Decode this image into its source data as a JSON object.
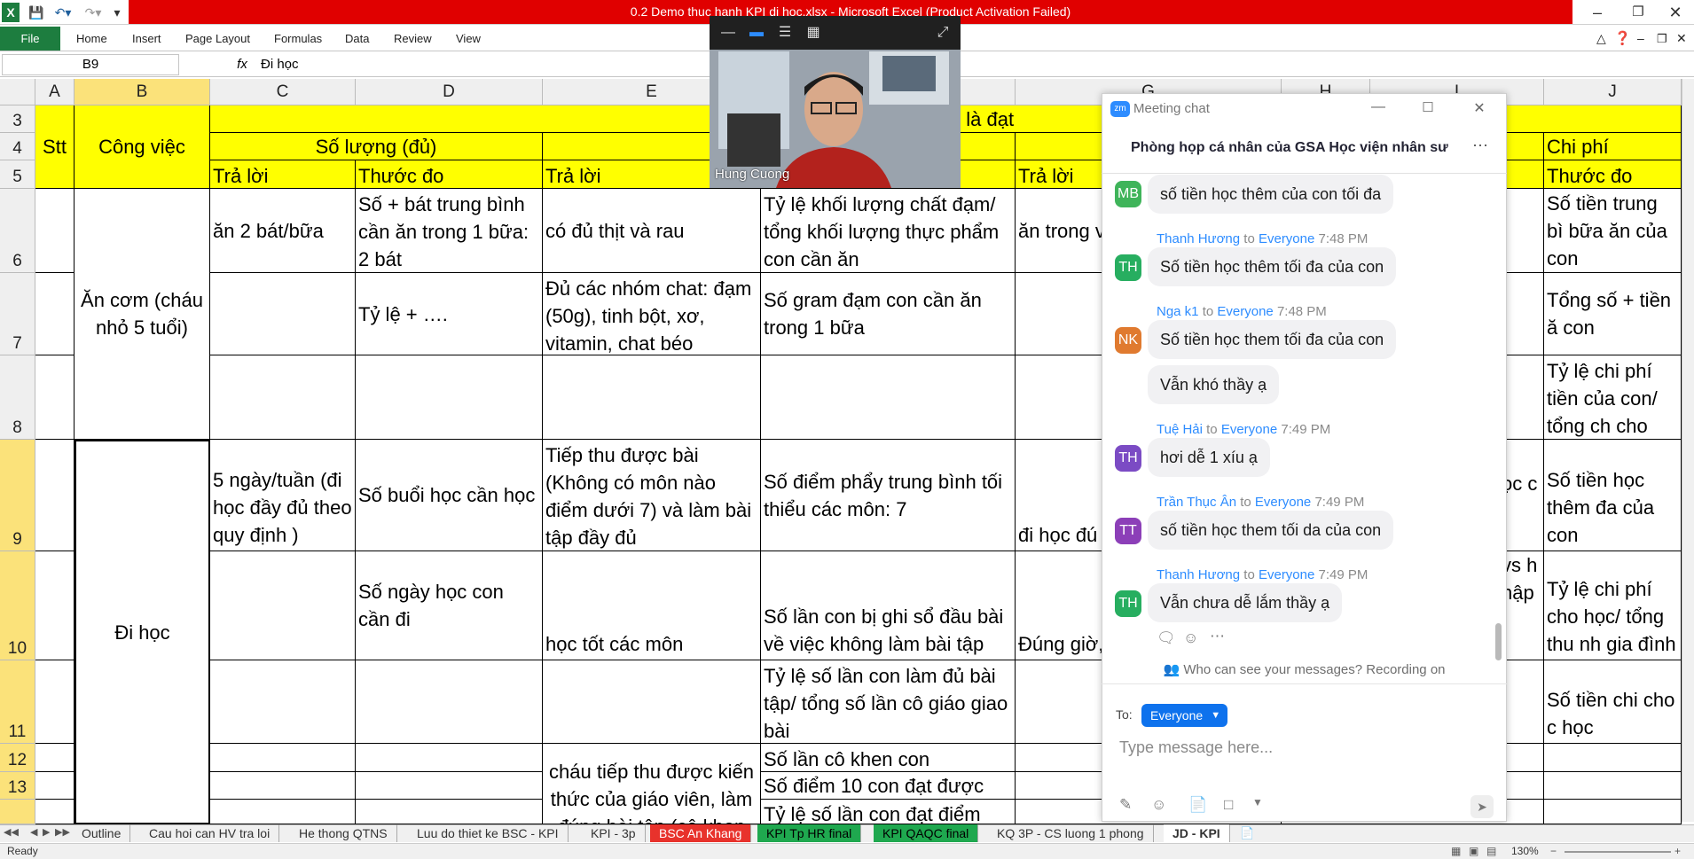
{
  "window": {
    "title": "0.2 Demo thuc hanh KPI di hoc.xlsx  -  Microsoft Excel (Product Activation Failed)",
    "accent": "#1d7d3f",
    "title_bg": "#e00000"
  },
  "ribbon": {
    "file": "File",
    "tabs": [
      "Home",
      "Insert",
      "Page Layout",
      "Formulas",
      "Data",
      "Review",
      "View"
    ]
  },
  "formula_bar": {
    "name_box": "B9",
    "fx": "fx",
    "content": "Đi học"
  },
  "columns": [
    "A",
    "B",
    "C",
    "D",
    "E",
    "F",
    "G",
    "H",
    "I",
    "J"
  ],
  "rows": [
    "3",
    "4",
    "5",
    "6",
    "7",
    "8",
    "9",
    "10",
    "11",
    "12",
    "13"
  ],
  "sheet": {
    "hdr_top_center": "ư thế nào là đạt",
    "stt": "Stt",
    "cong_viec": "Công việc",
    "so_luong": "Số lượng (đủ)",
    "chat_luong_partial": "C",
    "chi_phi": "Chi phí",
    "tra_loi": "Trả lời",
    "thuoc_do": "Thước đo",
    "c6": "ăn 2 bát/bữa",
    "d6": "Số + bát trung bình cần ăn trong 1 bữa: 2 bát",
    "e6": "có đủ thịt và rau",
    "f6": "Tỷ lệ khối lượng chất đạm/ tổng khối lượng thực phẩm con cần ăn",
    "g6": "ăn trong v 30p-45p",
    "j6": "Số tiền trung bì bữa ăn của con",
    "b7": "Ăn cơm (cháu nhỏ 5 tuổi)",
    "d7": "Tỷ lệ + ….",
    "e7": "Đủ các nhóm chat: đạm (50g), tinh bột, xơ, vitamin, chat béo",
    "f7": "Số gram đạm con cần ăn trong 1 bữa",
    "j7": "Tổng số + tiền ă con",
    "j8": "Tỷ lệ chi phí tiền của con/ tổng ch cho con",
    "b9": "Đi học",
    "c9": "5 ngày/tuần (đi học đầy đủ theo quy định )",
    "d9": "Số buổi học cần học",
    "e9": "Tiếp thu được bài (Không có môn nào điểm dưới 7) và làm bài tập đầy đủ",
    "f9": "Số điểm phẩy trung bình tối thiểu các môn: 7",
    "g9": "đi học đú giờ, Khôn trễ",
    "i9": "ọc c",
    "j9": "Số tiền học thêm đa của con",
    "d10": "Số ngày học con cần đi",
    "e10": "học tốt các môn",
    "f10": "Số lần con bị ghi sổ đầu bài về việc không làm bài tập",
    "g10": "Đúng giờ, buổi/ngày",
    "i10": "vs h hập",
    "j10": "Tỷ lệ chi phí cho học/ tổng thu nh gia đình",
    "f11": "Tỷ lệ số lần con làm đủ bài tập/ tổng số lần cô giáo giao bài",
    "j11": "Số tiền chi cho c học",
    "e12": "cháu tiếp thu được kiến thức của giáo viên, làm đúng bài tập (cô khen",
    "f12": "Số lần cô khen con",
    "f13": "Số điểm 10 con đạt được",
    "f14": "Tỷ lệ số lần con đạt điểm"
  },
  "video": {
    "name": "Hung Cuong"
  },
  "chat": {
    "title": "Meeting chat",
    "room": "Phòng họp cá nhân của GSA Học viện nhân sư",
    "messages": [
      {
        "initials": "MB",
        "color": "#3fb45a",
        "sender": "",
        "to": "",
        "time": "",
        "text": "số tiền học thêm của con tối đa"
      },
      {
        "initials": "TH",
        "color": "#27ae60",
        "sender": "Thanh Hương",
        "to": "Everyone",
        "time": "7:48 PM",
        "text": "Số tiền học thêm tối đa của con"
      },
      {
        "initials": "NK",
        "color": "#e07a2f",
        "sender": "Nga k1",
        "to": "Everyone",
        "time": "7:48 PM",
        "text": "Số tiền học them tối đa của con"
      },
      {
        "initials": "",
        "color": "",
        "sender": "",
        "to": "",
        "time": "",
        "text": "Vẫn khó thầy ạ"
      },
      {
        "initials": "TH",
        "color": "#7b4bc4",
        "sender": "Tuệ Hải",
        "to": "Everyone",
        "time": "7:49 PM",
        "text": "hơi dễ 1 xíu ạ"
      },
      {
        "initials": "TT",
        "color": "#8c3fb8",
        "sender": "Trần Thục Ân",
        "to": "Everyone",
        "time": "7:49 PM",
        "text": "số tiền học them tối da của con"
      },
      {
        "initials": "TH",
        "color": "#27ae60",
        "sender": "Thanh Hương",
        "to": "Everyone",
        "time": "7:49 PM",
        "text": "Vẫn chưa dễ lắm thầy ạ"
      }
    ],
    "to_word": "to",
    "privacy": "Who can see your messages? Recording on",
    "to_label": "To:",
    "recipient": "Everyone",
    "placeholder": "Type message here..."
  },
  "sheet_tabs": [
    {
      "label": "Outline",
      "color": ""
    },
    {
      "label": "Cau hoi can HV tra loi",
      "color": ""
    },
    {
      "label": "He thong QTNS",
      "color": ""
    },
    {
      "label": "Luu do thiet ke BSC - KPI",
      "color": ""
    },
    {
      "label": "KPI - 3p",
      "color": ""
    },
    {
      "label": "BSC An Khang",
      "color": "#e8322c"
    },
    {
      "label": "KPI Tp HR final",
      "color": "#1fa84f"
    },
    {
      "label": "KPI QAQC final",
      "color": "#1fa84f"
    },
    {
      "label": "KQ 3P - CS luong 1 phong",
      "color": ""
    },
    {
      "label": "JD - KPI",
      "color": ""
    }
  ],
  "status": {
    "left": "Ready",
    "zoom": "130%"
  }
}
